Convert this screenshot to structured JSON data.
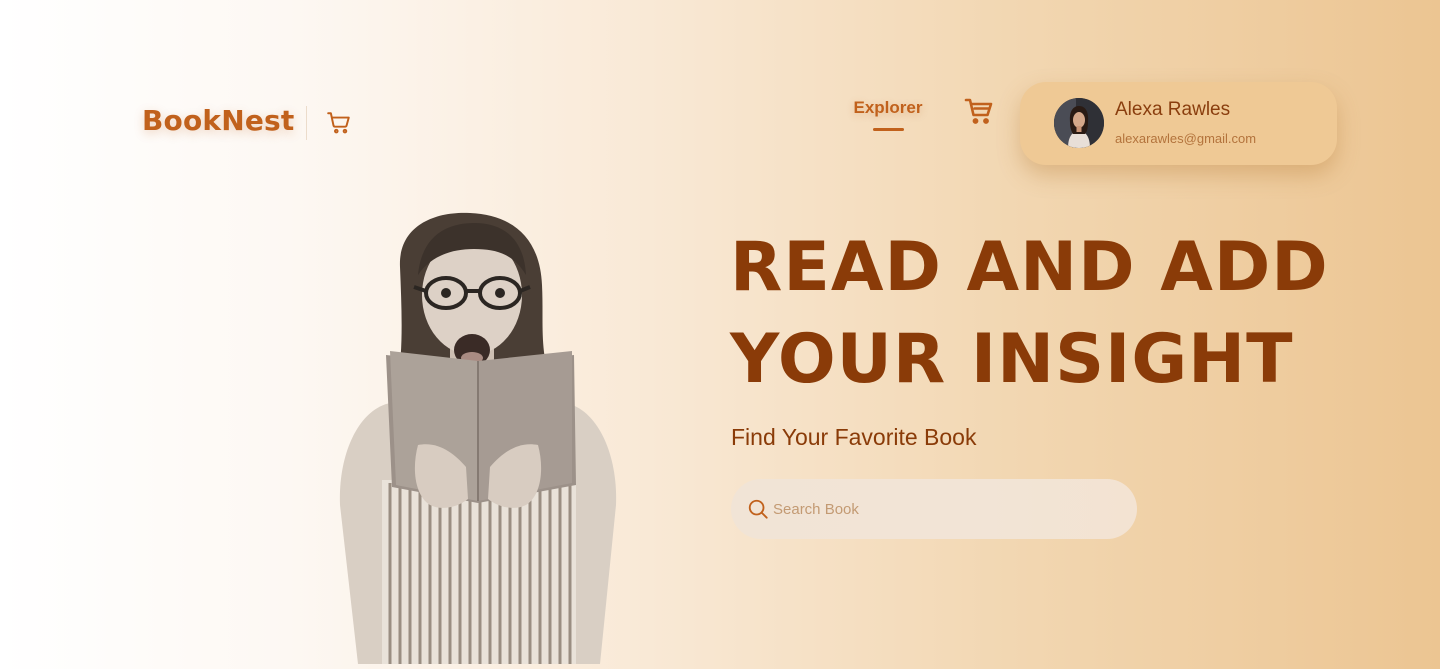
{
  "header": {
    "brand": "BookNest",
    "nav": {
      "explorer_label": "Explorer"
    },
    "icons": {
      "brand_cart": "shopping-cart-icon",
      "nav_cart": "shopping-cart-icon"
    }
  },
  "profile": {
    "name": "Alexa Rawles",
    "email": "alexarawles@gmail.com"
  },
  "hero": {
    "title_line1": "READ AND ADD",
    "title_line2": "YOUR INSIGHT",
    "subtitle": "Find Your Favorite Book",
    "search": {
      "placeholder": "Search Book",
      "value": ""
    }
  },
  "colors": {
    "brand": "#c1611c",
    "title": "#8a3b08",
    "profile_card": "#efc995"
  }
}
